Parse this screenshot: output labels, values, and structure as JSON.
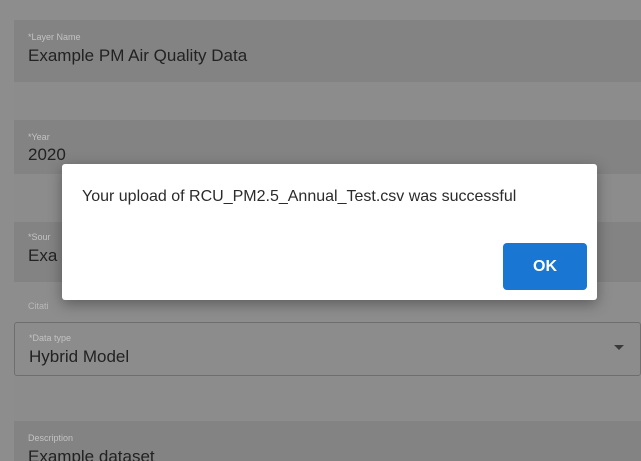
{
  "form": {
    "layer_name": {
      "label": "*Layer Name",
      "value": "Example PM Air Quality Data"
    },
    "year": {
      "label": "*Year",
      "value": "2020"
    },
    "source": {
      "label": "*Sour",
      "value": "Exa"
    },
    "citation": {
      "label": "Citati"
    },
    "data_type": {
      "label": "*Data type",
      "value": "Hybrid Model"
    },
    "description": {
      "label": "Description",
      "value": "Example dataset"
    }
  },
  "dialog": {
    "message": "Your upload of RCU_PM2.5_Annual_Test.csv was successful",
    "ok_label": "OK"
  },
  "colors": {
    "primary_button": "#1976d2",
    "overlay": "#8d8d8d"
  }
}
